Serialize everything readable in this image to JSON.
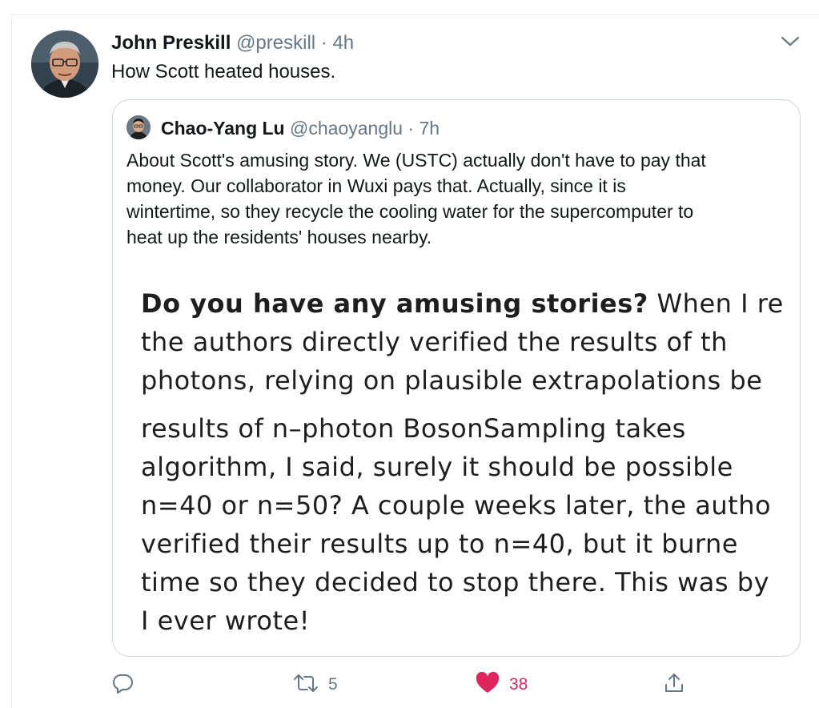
{
  "tweet": {
    "author_name": "John Preskill",
    "handle": "@preskill",
    "separator": "·",
    "time": "4h",
    "text": "How Scott heated houses."
  },
  "quoted_tweet": {
    "author_name": "Chao-Yang Lu",
    "handle": "@chaoyanglu",
    "separator": "·",
    "time": "7h",
    "text_lines": [
      "About Scott's amusing story. We (USTC) actually don't have to pay that",
      "money. Our collaborator in Wuxi pays that. Actually, since it is",
      "wintertime, so they recycle the cooling water for the supercomputer to",
      "heat up the residents' houses nearby."
    ],
    "image_text": {
      "bold_lead": "Do you have any amusing stories?",
      "first_line_rest": " When I re",
      "lines": [
        "the authors directly verified the results of th",
        "photons, relying on plausible extrapolations be",
        "results of n–photon BosonSampling takes",
        "algorithm, I said, surely it should be possible",
        "n=40 or n=50? A couple weeks later, the autho",
        "verified their results up to n=40, but it burne",
        "time so they decided to stop there. This was by",
        "I ever wrote!"
      ]
    }
  },
  "actions": {
    "reply": {
      "icon": "reply-icon",
      "count": ""
    },
    "retweet": {
      "icon": "retweet-icon",
      "count": "5"
    },
    "like": {
      "icon": "heart-icon",
      "count": "38",
      "liked": true
    },
    "share": {
      "icon": "share-icon",
      "count": ""
    }
  },
  "colors": {
    "text_primary": "#14171a",
    "text_secondary": "#657786",
    "like_active": "#e0245e",
    "border": "#ccd6dd"
  }
}
